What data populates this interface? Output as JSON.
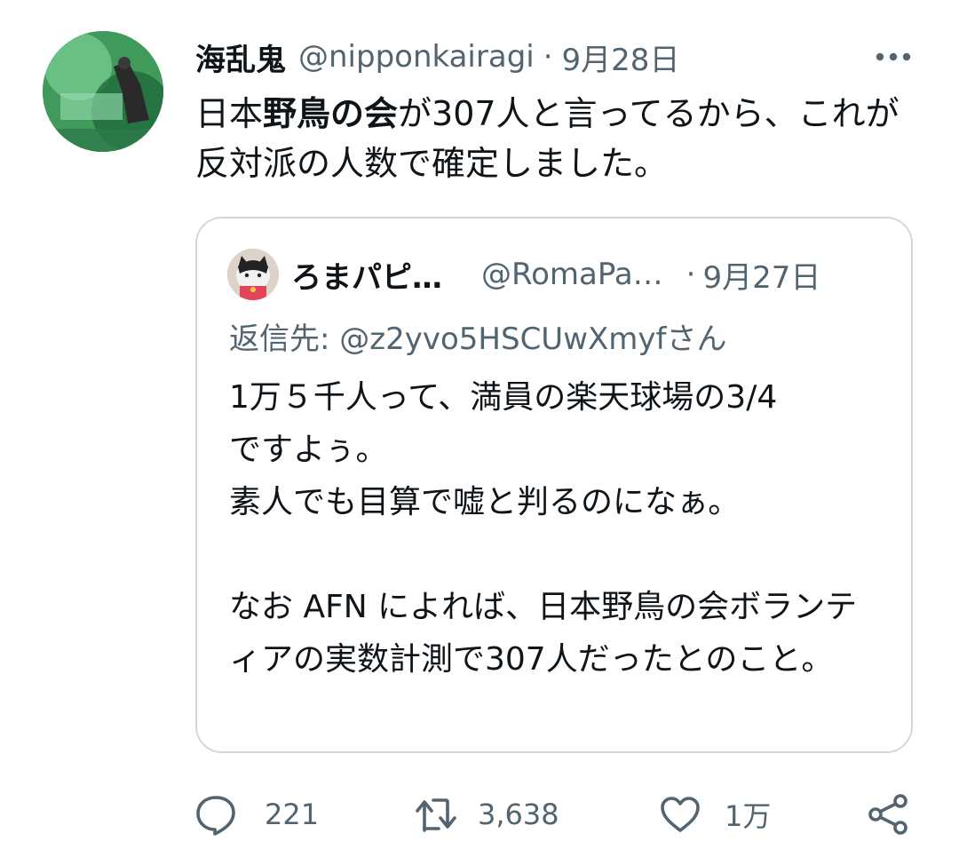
{
  "tweet": {
    "display_name": "海乱鬼",
    "handle": "@nipponkairagi",
    "dot": "·",
    "time": "9月28日",
    "text_part1": "日本",
    "text_bold": "野鳥の会",
    "text_part2": "が307人と言ってるから、これが反対派の人数で確定しました。"
  },
  "quote": {
    "display_name": "ろまパピ…",
    "handle": "@RomaPa…",
    "dot": "·",
    "time": "9月27日",
    "reply_to": "返信先: @z2yvo5HSCUwXmyfさん",
    "paragraph1": "1万５千人って、満員の楽天球場の3/4\nですよぅ。\n素人でも目算で嘘と判るのになぁ。",
    "paragraph2": "なお AFN によれば、日本野鳥の会ボランティアの実数計測で307人だったとのこと。"
  },
  "actions": {
    "reply_count": "221",
    "retweet_count": "3,638",
    "like_count": "1万"
  },
  "icons": {
    "more": "more-horizontal-icon",
    "reply": "reply-bubble-icon",
    "retweet": "retweet-icon",
    "like": "heart-icon",
    "share": "share-icon"
  },
  "colors": {
    "text_primary": "#0f1419",
    "text_secondary": "#536471",
    "border": "#cfd9de"
  }
}
